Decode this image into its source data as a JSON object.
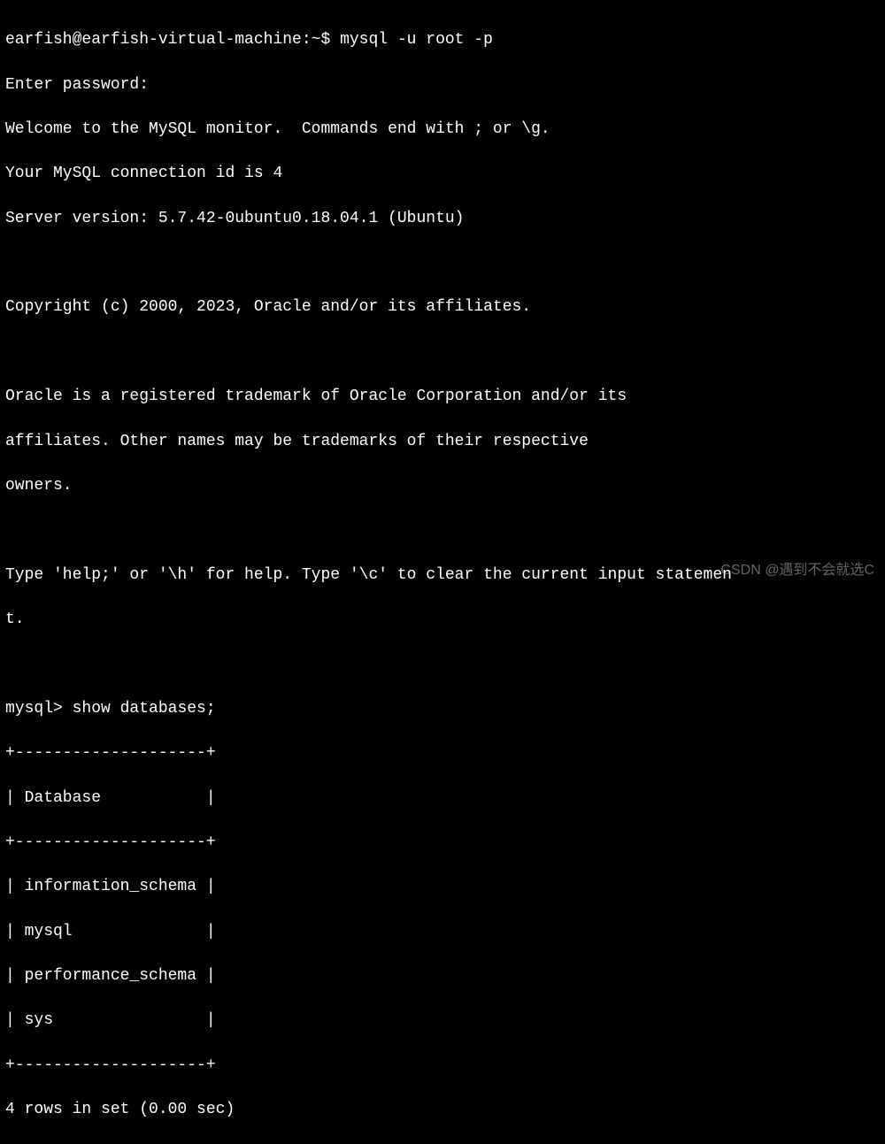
{
  "shell_prompt": "earfish@earfish-virtual-machine:~$ ",
  "shell_command": "mysql -u root -p",
  "password_prompt": "Enter password:",
  "welcome_line": "Welcome to the MySQL monitor.  Commands end with ; or \\g.",
  "connection_line": "Your MySQL connection id is 4",
  "server_version_line": "Server version: 5.7.42-0ubuntu0.18.04.1 (Ubuntu)",
  "copyright_line": "Copyright (c) 2000, 2023, Oracle and/or its affiliates.",
  "trademark_line1": "Oracle is a registered trademark of Oracle Corporation and/or its",
  "trademark_line2": "affiliates. Other names may be trademarks of their respective",
  "trademark_line3": "owners.",
  "help_line1": "Type 'help;' or '\\h' for help. Type '\\c' to clear the current input statemen",
  "help_line2": "t.",
  "mysql_prompt": "mysql> ",
  "mysql_command": "show databases;",
  "table_border": "+--------------------+",
  "table_header": "| Database           |",
  "table_rows": [
    "| information_schema |",
    "| mysql              |",
    "| performance_schema |",
    "| sys                |"
  ],
  "result_line": "4 rows in set (0.00 sec)",
  "watermark": "CSDN @遇到不会就选C"
}
